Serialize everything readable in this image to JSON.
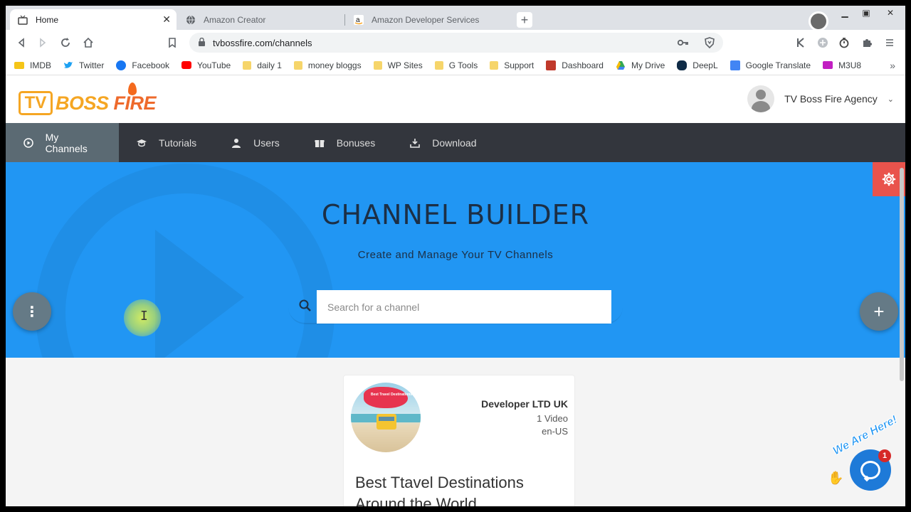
{
  "browser": {
    "tabs": [
      {
        "title": "Home",
        "active": true
      },
      {
        "title": "Amazon Creator",
        "active": false
      },
      {
        "title": "Amazon Developer Services",
        "active": false
      }
    ],
    "url": "tvbossfire.com/channels",
    "bookmarks": [
      {
        "label": "IMDB",
        "icon": "imdb-icon",
        "color": "#f5c518"
      },
      {
        "label": "Twitter",
        "icon": "twitter-icon",
        "color": "#1da1f2"
      },
      {
        "label": "Facebook",
        "icon": "facebook-icon",
        "color": "#1877f2"
      },
      {
        "label": "YouTube",
        "icon": "youtube-icon",
        "color": "#ff0000"
      },
      {
        "label": "daily 1",
        "icon": "folder-icon"
      },
      {
        "label": "money bloggs",
        "icon": "folder-icon"
      },
      {
        "label": "WP Sites",
        "icon": "folder-icon"
      },
      {
        "label": "G Tools",
        "icon": "folder-icon"
      },
      {
        "label": "Support",
        "icon": "folder-icon"
      },
      {
        "label": "Dashboard",
        "icon": "dashboard-icon",
        "color": "#c0392b"
      },
      {
        "label": "My Drive",
        "icon": "drive-icon",
        "color": "#34a853"
      },
      {
        "label": "DeepL",
        "icon": "deepl-icon",
        "color": "#0f2b46"
      },
      {
        "label": "Google Translate",
        "icon": "translate-icon",
        "color": "#4285f4"
      },
      {
        "label": "M3U8",
        "icon": "m3u8-icon",
        "color": "#c21fc2"
      }
    ]
  },
  "site": {
    "logo": {
      "tv": "TV",
      "boss": "BOSS",
      "fire": "FIRE"
    },
    "user": {
      "name": "TV Boss Fire Agency"
    },
    "nav": [
      {
        "label": "My Channels",
        "icon": "play-circle-icon",
        "active": true
      },
      {
        "label": "Tutorials",
        "icon": "graduation-cap-icon",
        "active": false
      },
      {
        "label": "Users",
        "icon": "user-icon",
        "active": false
      },
      {
        "label": "Bonuses",
        "icon": "gift-icon",
        "active": false
      },
      {
        "label": "Download",
        "icon": "download-icon",
        "active": false
      }
    ],
    "hero": {
      "title": "CHANNEL BUILDER",
      "subtitle": "Create and Manage Your TV Channels",
      "search_placeholder": "Search for a channel"
    },
    "card": {
      "owner": "Developer LTD UK",
      "video_count": "1 Video",
      "language": "en-US",
      "title": "Best Ttavel Destinations Around the World",
      "thumb_text": "Best Travel Destinations"
    },
    "chat": {
      "label": "We Are Here!",
      "badge": "1"
    }
  },
  "colors": {
    "hero_bg": "#2196f3",
    "nav_bg": "#33363d",
    "nav_active": "#5b6a73",
    "settings_button": "#e9534c",
    "logo_orange": "#f5a623",
    "chat_blue": "#1e7ad8"
  }
}
